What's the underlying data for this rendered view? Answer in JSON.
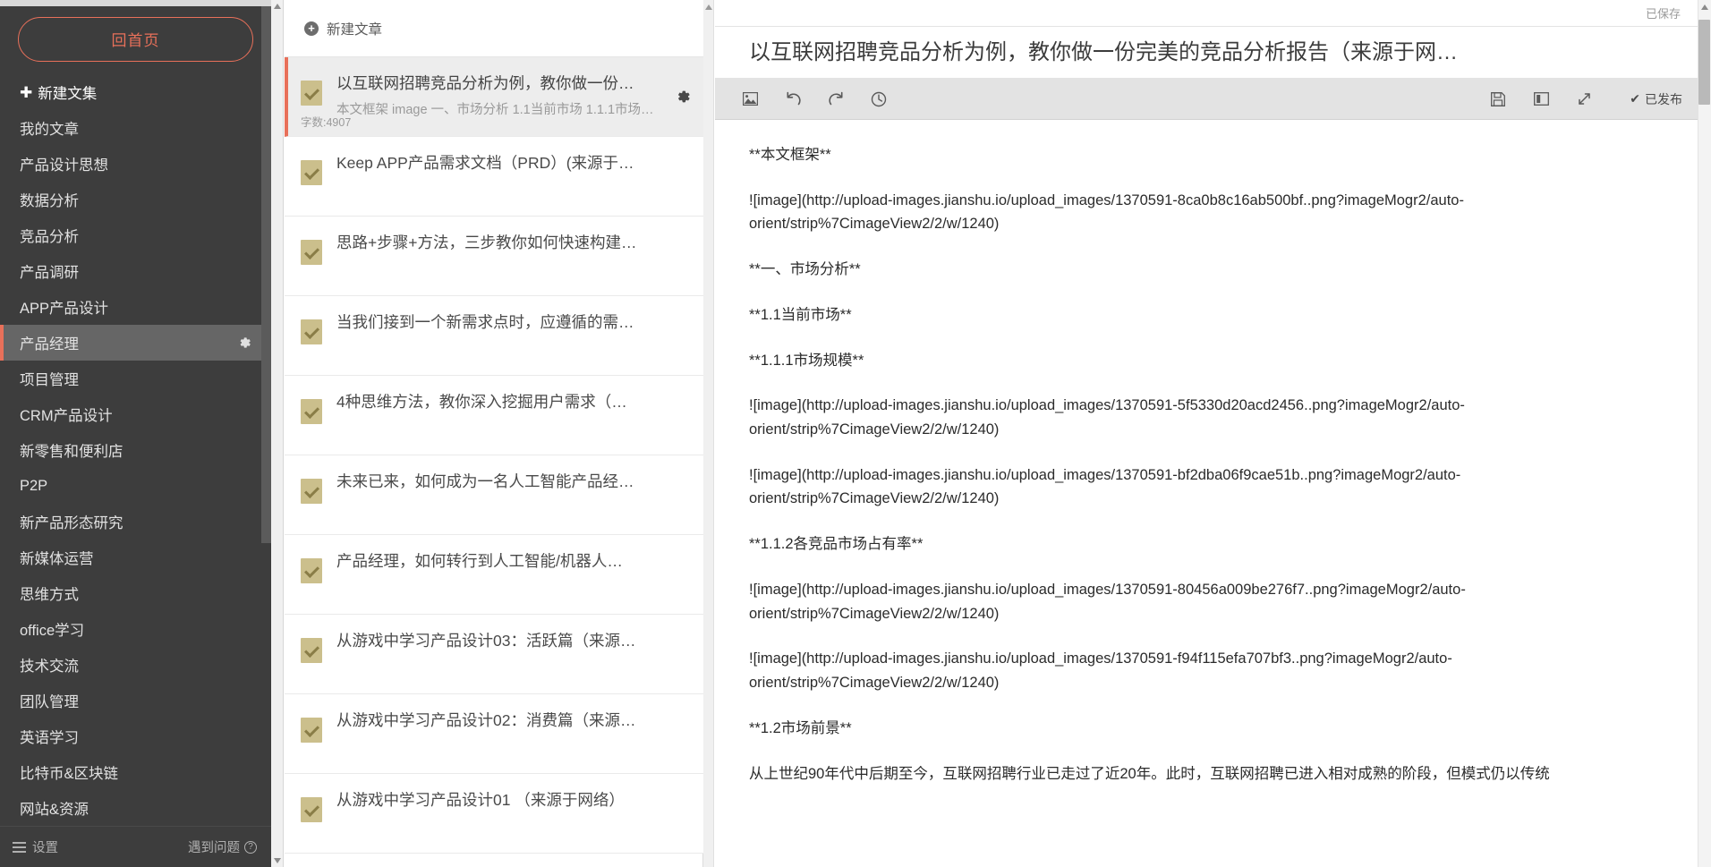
{
  "sidebar": {
    "home_button": "回首页",
    "new_collection": "新建文集",
    "items": [
      {
        "label": "我的文章",
        "active": false
      },
      {
        "label": "产品设计思想",
        "active": false
      },
      {
        "label": "数据分析",
        "active": false
      },
      {
        "label": "竞品分析",
        "active": false
      },
      {
        "label": "产品调研",
        "active": false
      },
      {
        "label": "APP产品设计",
        "active": false
      },
      {
        "label": "产品经理",
        "active": true
      },
      {
        "label": "项目管理",
        "active": false
      },
      {
        "label": "CRM产品设计",
        "active": false
      },
      {
        "label": "新零售和便利店",
        "active": false
      },
      {
        "label": "P2P",
        "active": false
      },
      {
        "label": "新产品形态研究",
        "active": false
      },
      {
        "label": "新媒体运营",
        "active": false
      },
      {
        "label": "思维方式",
        "active": false
      },
      {
        "label": "office学习",
        "active": false
      },
      {
        "label": "技术交流",
        "active": false
      },
      {
        "label": "团队管理",
        "active": false
      },
      {
        "label": "英语学习",
        "active": false
      },
      {
        "label": "比特币&区块链",
        "active": false
      },
      {
        "label": "网站&资源",
        "active": false
      }
    ],
    "footer": {
      "settings": "设置",
      "help": "遇到问题",
      "help_icon": "?"
    }
  },
  "list_pane": {
    "new_article": "新建文章",
    "articles": [
      {
        "title": "以互联网招聘竞品分析为例，教你做一份…",
        "snippet": "本文框架 image 一、市场分析 1.1当前市场 1.1.1市场…",
        "wordcount": "字数:4907",
        "selected": true
      },
      {
        "title": "Keep APP产品需求文档（PRD）(来源于…",
        "snippet": "",
        "wordcount": "",
        "selected": false
      },
      {
        "title": "思路+步骤+方法，三步教你如何快速构建…",
        "snippet": "",
        "wordcount": "",
        "selected": false
      },
      {
        "title": "当我们接到一个新需求点时，应遵循的需…",
        "snippet": "",
        "wordcount": "",
        "selected": false
      },
      {
        "title": "4种思维方法，教你深入挖掘用户需求（…",
        "snippet": "",
        "wordcount": "",
        "selected": false
      },
      {
        "title": "未来已来，如何成为一名人工智能产品经…",
        "snippet": "",
        "wordcount": "",
        "selected": false
      },
      {
        "title": "产品经理，如何转行到人工智能/机器人…",
        "snippet": "",
        "wordcount": "",
        "selected": false
      },
      {
        "title": "从游戏中学习产品设计03：活跃篇（来源…",
        "snippet": "",
        "wordcount": "",
        "selected": false
      },
      {
        "title": "从游戏中学习产品设计02：消费篇（来源…",
        "snippet": "",
        "wordcount": "",
        "selected": false
      },
      {
        "title": "从游戏中学习产品设计01 （来源于网络）",
        "snippet": "",
        "wordcount": "",
        "selected": false
      }
    ]
  },
  "editor": {
    "saved_status": "已保存",
    "document_title": "以互联网招聘竞品分析为例，教你做一份完美的竞品分析报告（来源于网…",
    "toolbar": {
      "image_icon": "image-icon",
      "undo_icon": "undo-icon",
      "redo_icon": "redo-icon",
      "history_icon": "history-clock-icon",
      "save_icon": "floppy-save-icon",
      "split_view_icon": "split-view-icon",
      "fullscreen_icon": "fullscreen-expand-icon",
      "publish_label": "已发布",
      "publish_check": "✔"
    },
    "content_lines": [
      "**本文框架**",
      "![image](http://upload-images.jianshu.io/upload_images/1370591-8ca0b8c16ab500bf..png?imageMogr2/auto-orient/strip%7CimageView2/2/w/1240)",
      "**一、市场分析**",
      "**1.1当前市场**",
      "**1.1.1市场规模**",
      "![image](http://upload-images.jianshu.io/upload_images/1370591-5f5330d20acd2456..png?imageMogr2/auto-orient/strip%7CimageView2/2/w/1240)",
      "![image](http://upload-images.jianshu.io/upload_images/1370591-bf2dba06f9cae51b..png?imageMogr2/auto-orient/strip%7CimageView2/2/w/1240)",
      "**1.1.2各竞品市场占有率**",
      "![image](http://upload-images.jianshu.io/upload_images/1370591-80456a009be276f7..png?imageMogr2/auto-orient/strip%7CimageView2/2/w/1240)",
      "![image](http://upload-images.jianshu.io/upload_images/1370591-f94f115efa707bf3..png?imageMogr2/auto-orient/strip%7CimageView2/2/w/1240)",
      "**1.2市场前景**",
      "从上世纪90年代中后期至今，互联网招聘行业已走过了近20年。此时，互联网招聘已进入相对成熟的阶段，但模式仍以传统"
    ]
  },
  "colors": {
    "accent": "#e8705a",
    "sidebar_bg": "#3d3d3d",
    "sidebar_active_bg": "#666666",
    "doc_icon": "#cbbf8c",
    "toolbar_bg": "#e3e3e3"
  }
}
